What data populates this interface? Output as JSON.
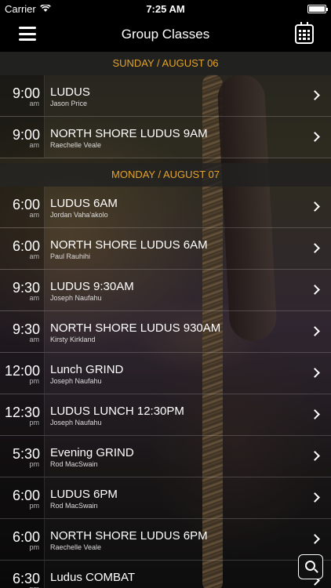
{
  "status_bar": {
    "carrier": "Carrier",
    "time": "7:25 AM"
  },
  "navbar": {
    "title": "Group Classes"
  },
  "days": [
    {
      "header": "SUNDAY / AUGUST 06",
      "classes": [
        {
          "time": "9:00",
          "ampm": "am",
          "name": "LUDUS",
          "instructor": "Jason Price"
        },
        {
          "time": "9:00",
          "ampm": "am",
          "name": "NORTH SHORE LUDUS 9AM",
          "instructor": "Raechelle Veale"
        }
      ]
    },
    {
      "header": "MONDAY / AUGUST 07",
      "classes": [
        {
          "time": "6:00",
          "ampm": "am",
          "name": "LUDUS 6AM",
          "instructor": "Jordan Vaha'akolo"
        },
        {
          "time": "6:00",
          "ampm": "am",
          "name": "NORTH SHORE LUDUS 6AM",
          "instructor": "Paul Rauhihi"
        },
        {
          "time": "9:30",
          "ampm": "am",
          "name": "LUDUS 9:30AM",
          "instructor": "Joseph Naufahu"
        },
        {
          "time": "9:30",
          "ampm": "am",
          "name": "NORTH SHORE LUDUS 930AM",
          "instructor": "Kirsty Kirkland"
        },
        {
          "time": "12:00",
          "ampm": "pm",
          "name": "Lunch GRIND",
          "instructor": "Joseph Naufahu"
        },
        {
          "time": "12:30",
          "ampm": "pm",
          "name": "LUDUS LUNCH 12:30PM",
          "instructor": "Joseph Naufahu"
        },
        {
          "time": "5:30",
          "ampm": "pm",
          "name": "Evening GRIND",
          "instructor": "Rod MacSwain"
        },
        {
          "time": "6:00",
          "ampm": "pm",
          "name": "LUDUS 6PM",
          "instructor": "Rod MacSwain"
        },
        {
          "time": "6:00",
          "ampm": "pm",
          "name": "NORTH SHORE LUDUS 6PM",
          "instructor": "Raechelle Veale"
        },
        {
          "time": "6:30",
          "ampm": "pm",
          "name": "Ludus COMBAT",
          "instructor": ""
        }
      ]
    }
  ]
}
